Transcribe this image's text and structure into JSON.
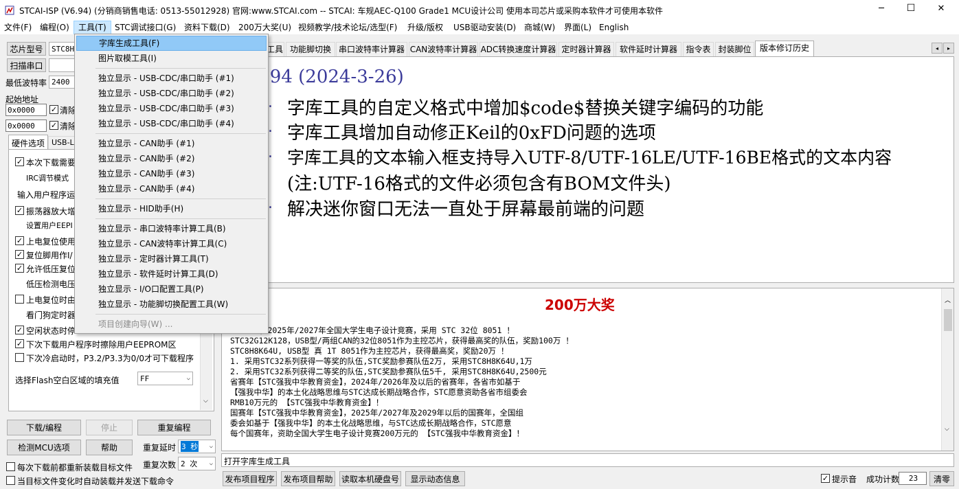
{
  "window": {
    "title": "STCAI-ISP (V6.94) (分销商销售电话: 0513-55012928) 官网:www.STCAI.com  -- STCAI: 车规AEC-Q100 Grade1 MCU设计公司 使用本司芯片或采购本软件才可使用本软件",
    "minimize": "─",
    "maximize": "☐",
    "close": "✕"
  },
  "menubar": {
    "items": [
      "文件(F)",
      "编程(O)",
      "工具(T)",
      "STC调试接口(G)",
      "资料下载(D)",
      "200万大奖(U)",
      "视频教学/技术论坛/选型(F)",
      "升级/版权",
      "USB驱动安装(D)",
      "商城(W)",
      "界面(L)",
      "English"
    ]
  },
  "tools_menu": {
    "items": [
      "字库生成工具(F)",
      "图片取模工具(I)",
      "独立显示 - USB-CDC/串口助手 (#1)",
      "独立显示 - USB-CDC/串口助手 (#2)",
      "独立显示 - USB-CDC/串口助手 (#3)",
      "独立显示 - USB-CDC/串口助手 (#4)",
      "独立显示 - CAN助手 (#1)",
      "独立显示 - CAN助手 (#2)",
      "独立显示 - CAN助手 (#3)",
      "独立显示 - CAN助手 (#4)",
      "独立显示 - HID助手(H)",
      "独立显示 - 串口波特率计算工具(B)",
      "独立显示 - CAN波特率计算工具(C)",
      "独立显示 - 定时器计算工具(T)",
      "独立显示 - 软件延时计算工具(D)",
      "独立显示 - I/O口配置工具(P)",
      "独立显示 - 功能脚切换配置工具(W)",
      "项目创建向导(W) ..."
    ]
  },
  "left": {
    "chip_type_btn": "芯片型号",
    "chip_type_value": "STC8H",
    "scan_port_btn": "扫描串口",
    "min_baud_label": "最低波特率",
    "min_baud_value": "2400",
    "start_addr_label": "起始地址",
    "addr1": "0x0000",
    "addr2": "0x0000",
    "clear1": "清除",
    "clear2": "清除",
    "tab_hw": "硬件选项",
    "tab_usb": "USB-L",
    "options": [
      "本次下载需要",
      "IRC调节模式",
      "输入用户程序运",
      "振荡器放大增",
      "设置用户EEPI",
      "上电复位使用",
      "复位脚用作I/",
      "允许低压复位",
      "低压检测电压",
      "上电复位时由",
      "看门狗定时器",
      "空闲状态时停",
      "下次下载用户程序时擦除用户EEPROM区",
      "下次冷启动时，P3.2/P3.3为0/0才可下载程序"
    ],
    "fill_label": "选择Flash空白区域的填充值",
    "fill_value": "FF",
    "download_btn": "下载/编程",
    "stop_btn": "停止",
    "reprogram_btn": "重复编程",
    "detect_btn": "检测MCU选项",
    "help_btn": "帮助",
    "repeat_delay_label": "重复延时",
    "repeat_delay_value": "3 秒",
    "repeat_count_label": "重复次数",
    "repeat_count_value": "2 次",
    "reload_each": "每次下载前都重新装载目标文件",
    "auto_reload": "当目标文件变化时自动装载并发送下载命令"
  },
  "tabs": [
    "工具",
    "功能脚切换",
    "串口波特率计算器",
    "CAN波特率计算器",
    "ADC转换速度计算器",
    "定时器计算器",
    "软件延时计算器",
    "指令表",
    "封装脚位",
    "版本修订历史"
  ],
  "notes": {
    "version": "6.94 (2024-3-26)",
    "lines": [
      "字库工具的自定义格式中增加$code$替换关键字编码的功能",
      "字库工具增加自动修正Keil的0xFD问题的选项",
      "字库工具的文本输入框支持导入UTF-8/UTF-16LE/UTF-16BE格式的文本内容",
      "(注:UTF-16格式的文件必须包含有BOM文件头)",
      "解决迷你窗口无法一直处于屏幕最前端的问题"
    ]
  },
  "contest": {
    "title": "200万大奖",
    "lines": [
      "，2025年/2027年全国大学生电子设计竞赛，采用 STC 32位 8051 ！",
      "STC32G12K128，USB型/两组CAN的32位8051作为主控芯片，获得最高奖的队伍，奖励100万 ！",
      "STC8H8K64U, USB型 真 1T 8051作为主控芯片，获得最高奖，奖励20万 ！",
      "1. 采用STC32系列获得一等奖的队伍,STC奖励参赛队伍2万, 采用STC8H8K64U,1万",
      "2. 采用STC32系列获得二等奖的队伍,STC奖励参赛队伍5千, 采用STC8H8K64U,2500元",
      "省赛年【STC强我中华教育资金】，2024年/2026年及以后的省赛年，各省市如基于",
      "【强我中华】的本土化战略思维与STC达成长期战略合作，STC愿意资助各省市组委会",
      "RMB10万元的 【STC强我中华教育资金】！",
      "国赛年【STC强我中华教育资金】，2025年/2027年及2029年以后的国赛年，全国组",
      "委会如基于【强我中华】的本土化战略思维，与STC达成长期战略合作，STC愿意",
      "每个国赛年，资助全国大学生电子设计竞赛200万元的 【STC强我中华教育资金】！"
    ]
  },
  "status": {
    "message": "打开字库生成工具",
    "publish_btn": "发布项目程序",
    "publish_help_btn": "发布项目帮助",
    "read_disk_btn": "读取本机硬盘号",
    "show_dynamic_btn": "显示动态信息",
    "sound_label": "提示音",
    "success_label": "成功计数",
    "success_count": "23",
    "clear_btn": "清零"
  },
  "colors": {
    "accent": "#cc0000",
    "menu_highlight": "#91c9f7"
  }
}
